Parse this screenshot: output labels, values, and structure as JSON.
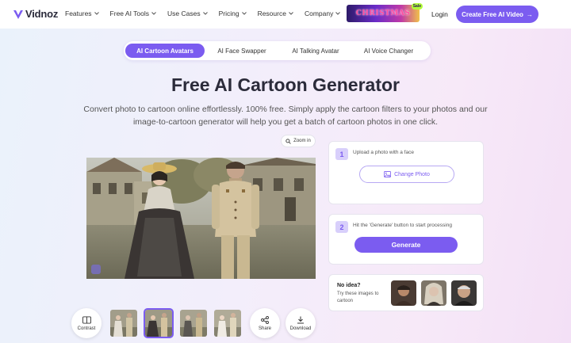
{
  "nav": {
    "logo_text": "Vidnoz",
    "menu": [
      "Features",
      "Free AI Tools",
      "Use Cases",
      "Pricing",
      "Resource",
      "Company"
    ],
    "promo_text": "CHRISTMAS",
    "promo_badge": "Sale",
    "login": "Login",
    "cta": "Create Free AI Video",
    "cta_arrow": "→"
  },
  "tabs": [
    "AI Cartoon Avatars",
    "AI Face Swapper",
    "AI Talking Avatar",
    "AI Voice Changer"
  ],
  "hero": {
    "title": "Free AI Cartoon Generator",
    "subtitle": "Convert photo to cartoon online effortlessly. 100% free. Simply apply the cartoon filters to your photos and our image-to-cartoon generator will help you get a batch of cartoon photos in one click."
  },
  "viewer": {
    "zoom_label": "Zoom in",
    "contrast_label": "Contrast",
    "share_label": "Share",
    "download_label": "Download",
    "selected_thumb_index": 1
  },
  "steps": {
    "step1_num": "1",
    "step1_text": "Upload a photo with a face",
    "change_photo": "Change Photo",
    "step2_num": "2",
    "step2_text": "Hit the 'Generate' button to start processing",
    "generate": "Generate"
  },
  "ideas": {
    "title": "No idea?",
    "subtitle": "Try these images to cartoon"
  },
  "colors": {
    "accent": "#7b5cf0",
    "accent_light": "#d8cffb"
  }
}
